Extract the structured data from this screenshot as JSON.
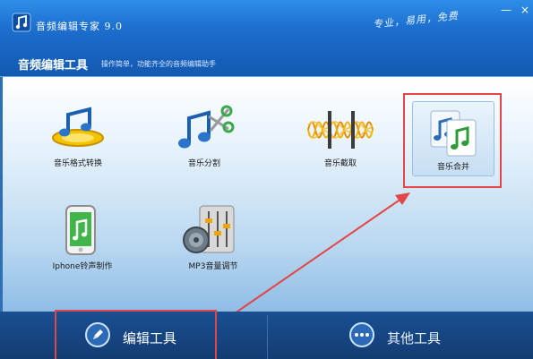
{
  "window": {
    "title": "音频编辑专家 9.0",
    "slogan": "专业，易用，免费",
    "minimize_label": "—",
    "close_label": "×"
  },
  "section": {
    "title": "音频编辑工具",
    "description": "操作简单，功能齐全的音频编辑助手"
  },
  "tools": [
    {
      "label": "音乐格式转换",
      "icon": "music-note-disc-icon"
    },
    {
      "label": "音乐分割",
      "icon": "music-note-scissors-icon"
    },
    {
      "label": "音乐截取",
      "icon": "waveform-crop-icon"
    },
    {
      "label": "音乐合并",
      "icon": "music-files-merge-icon",
      "selected": true
    },
    {
      "label": "Iphone铃声制作",
      "icon": "phone-music-icon"
    },
    {
      "label": "MP3音量调节",
      "icon": "volume-mixer-icon"
    }
  ],
  "bottom_nav": [
    {
      "label": "编辑工具",
      "icon": "pencil-icon",
      "active": true
    },
    {
      "label": "其他工具",
      "icon": "more-dots-icon"
    }
  ],
  "colors": {
    "title_bar": "#1c6fcf",
    "bottom_bar": "#123d73",
    "highlight": "#e24646"
  }
}
